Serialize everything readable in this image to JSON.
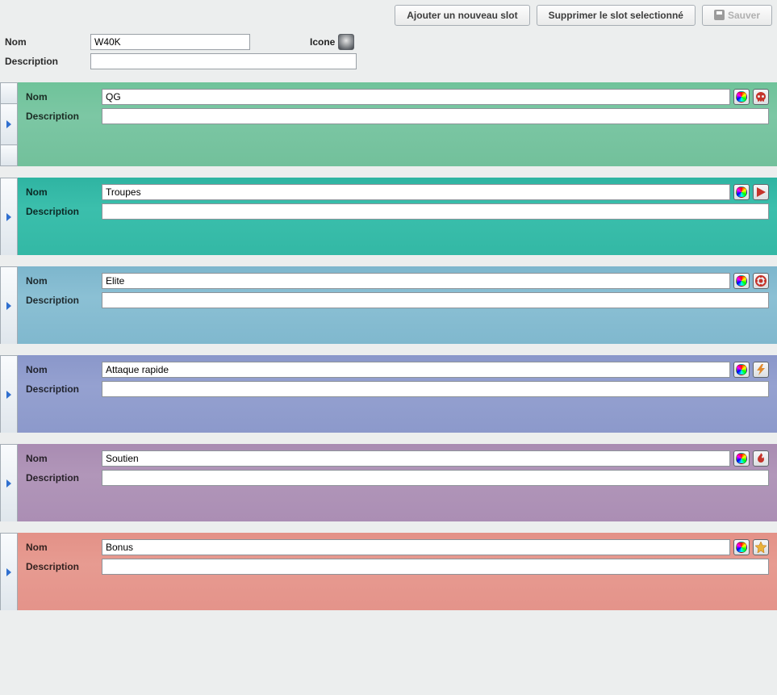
{
  "toolbar": {
    "add_label": "Ajouter un nouveau slot",
    "delete_label": "Supprimer le slot selectionné",
    "save_label": "Sauver"
  },
  "header": {
    "name_label": "Nom",
    "name_value": "W40K",
    "icone_label": "Icone",
    "desc_label": "Description",
    "desc_value": ""
  },
  "slot_labels": {
    "name": "Nom",
    "desc": "Description"
  },
  "slots": [
    {
      "id": "qg",
      "name": "QG",
      "desc": "",
      "bg": "bg-green",
      "icon": "skull"
    },
    {
      "id": "troupes",
      "name": "Troupes",
      "desc": "",
      "bg": "bg-teal",
      "icon": "play"
    },
    {
      "id": "elite",
      "name": "Elite",
      "desc": "",
      "bg": "bg-blue",
      "icon": "target"
    },
    {
      "id": "attaque",
      "name": "Attaque rapide",
      "desc": "",
      "bg": "bg-slate",
      "icon": "bolt"
    },
    {
      "id": "soutien",
      "name": "Soutien",
      "desc": "",
      "bg": "bg-purple",
      "icon": "flame"
    },
    {
      "id": "bonus",
      "name": "Bonus",
      "desc": "",
      "bg": "bg-red",
      "icon": "star"
    }
  ]
}
